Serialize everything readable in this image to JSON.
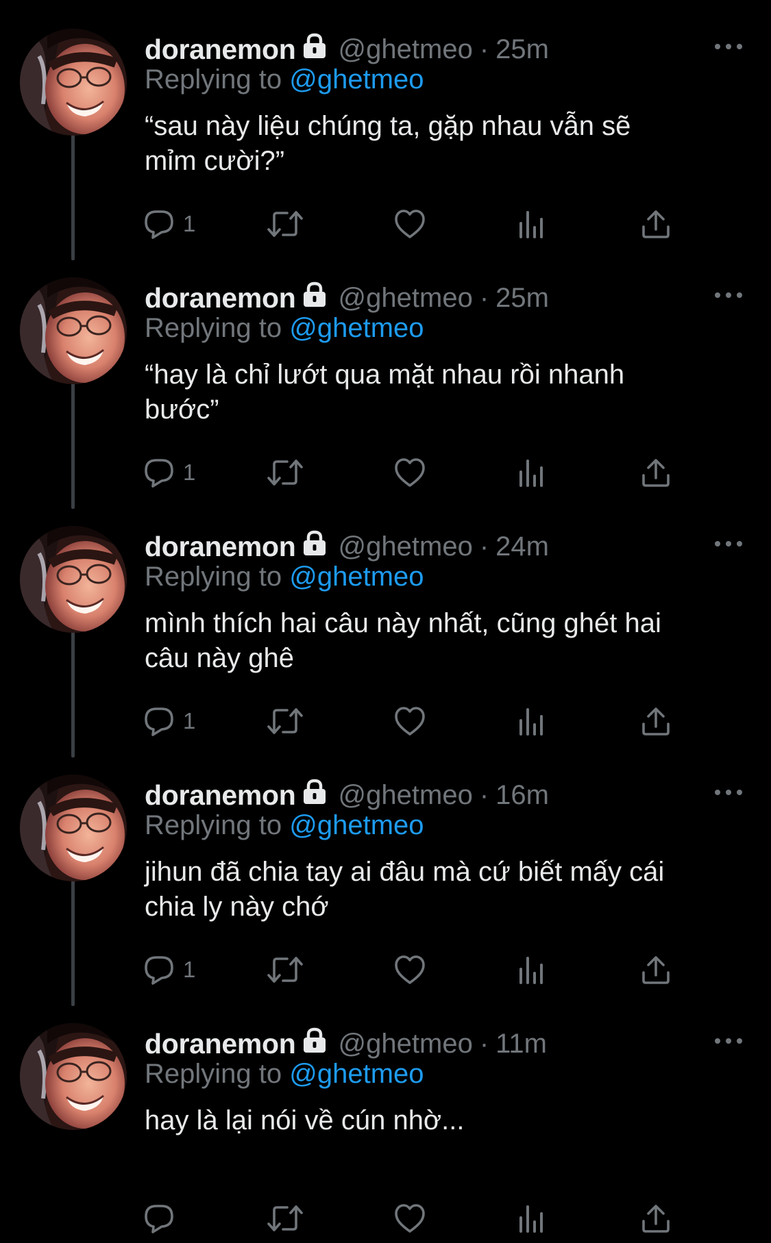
{
  "colors": {
    "background": "#000000",
    "primary_text": "#e7e9ea",
    "secondary_text": "#71767b",
    "link": "#1d9bf0",
    "thread_line": "#3a3f44"
  },
  "icons": {
    "reply": "speech-bubble-icon",
    "retweet": "retweet-icon",
    "like": "heart-icon",
    "views": "bar-chart-icon",
    "share": "share-upload-icon",
    "more": "more-horizontal-icon",
    "protected": "lock-icon"
  },
  "replying_prefix": "Replying to",
  "tweets": [
    {
      "display_name": "doranemon",
      "handle": "@ghetmeo",
      "separator": "·",
      "time": "25m",
      "replying_to": "@ghetmeo",
      "text": "“sau này liệu chúng ta, gặp nhau vẫn sẽ\nmỉm cười?”",
      "reply_count": "1"
    },
    {
      "display_name": "doranemon",
      "handle": "@ghetmeo",
      "separator": "·",
      "time": "25m",
      "replying_to": "@ghetmeo",
      "text": "“hay là chỉ lướt qua mặt nhau rồi nhanh\nbước”",
      "reply_count": "1"
    },
    {
      "display_name": "doranemon",
      "handle": "@ghetmeo",
      "separator": "·",
      "time": "24m",
      "replying_to": "@ghetmeo",
      "text": "mình thích hai câu này nhất, cũng ghét hai\ncâu này ghê",
      "reply_count": "1"
    },
    {
      "display_name": "doranemon",
      "handle": "@ghetmeo",
      "separator": "·",
      "time": "16m",
      "replying_to": "@ghetmeo",
      "text": "jihun đã chia tay ai đâu mà cứ biết mấy cái\nchia ly này chớ",
      "reply_count": "1"
    },
    {
      "display_name": "doranemon",
      "handle": "@ghetmeo",
      "separator": "·",
      "time": "11m",
      "replying_to": "@ghetmeo",
      "text": "hay là lại nói về cún nhờ...",
      "reply_count": ""
    }
  ]
}
